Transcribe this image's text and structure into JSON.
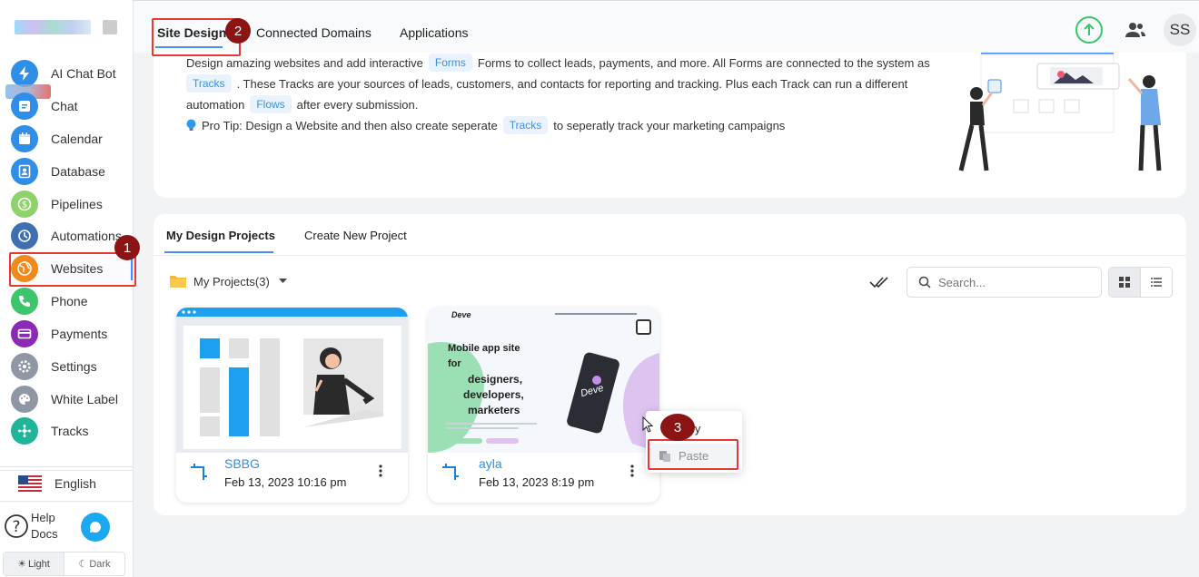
{
  "nav": {
    "items": [
      {
        "label": "AI Chat Bot",
        "icon": "bolt-icon",
        "color": "#2f8ee6"
      },
      {
        "label": "Chat",
        "icon": "chat-icon",
        "color": "#2f8ee6"
      },
      {
        "label": "Calendar",
        "icon": "calendar-icon",
        "color": "#2f8ee6"
      },
      {
        "label": "Database",
        "icon": "contacts-icon",
        "color": "#2f8ee6"
      },
      {
        "label": "Pipelines",
        "icon": "dollar-icon",
        "color": "#8fd16b"
      },
      {
        "label": "Automations",
        "icon": "automation-icon",
        "color": "#3e6fb0"
      },
      {
        "label": "Websites",
        "icon": "globe-icon",
        "color": "#f08a1c"
      },
      {
        "label": "Phone",
        "icon": "phone-icon",
        "color": "#3cc56a"
      },
      {
        "label": "Payments",
        "icon": "card-icon",
        "color": "#8b2bb5"
      },
      {
        "label": "Settings",
        "icon": "gear-icon",
        "color": "#8e97a3"
      },
      {
        "label": "White Label",
        "icon": "palette-icon",
        "color": "#8e97a3"
      },
      {
        "label": "Tracks",
        "icon": "tracks-icon",
        "color": "#20b59b"
      }
    ],
    "language": "English",
    "help": "Help",
    "docs": "Docs",
    "theme_light": "Light",
    "theme_dark": "Dark"
  },
  "tabs": {
    "site_designs": "Site Designs",
    "connected_domains": "Connected Domains",
    "applications": "Applications"
  },
  "header": {
    "avatar": "SS"
  },
  "intro": {
    "l1a": "Design amazing websites and add interactive",
    "pill_forms": "Forms",
    "l1b": "Forms to collect leads, payments, and more. All Forms are connected to the system as",
    "pill_tracks1": "Tracks",
    "l2": ". These Tracks are your sources of leads, customers, and contacts for reporting and tracking. Plus each Track can run a different",
    "l3a": "automation",
    "pill_flows": "Flows",
    "l3b": "after every submission.",
    "l4a": "Pro Tip: Design a Website and then also create seperate",
    "pill_tracks2": "Tracks",
    "l4b": "to seperatly track your marketing campaigns"
  },
  "projects": {
    "tab_my": "My Design Projects",
    "tab_create": "Create New Project",
    "folder": "My Projects(3)",
    "search_placeholder": "Search...",
    "items": [
      {
        "name": "SBBG",
        "date": "Feb 13, 2023 10:16 pm"
      },
      {
        "name": "ayla",
        "date": "Feb 13, 2023 8:19 pm"
      }
    ],
    "thumb2": {
      "brand": "Deve",
      "headline1": "Mobile app site",
      "headline2": "for",
      "headline3": "designers,",
      "headline4": "developers,",
      "headline5": "marketers",
      "phone_text": "Deve"
    }
  },
  "context_menu": {
    "copy": "Copy",
    "paste": "Paste"
  },
  "badges": [
    "1",
    "2",
    "3"
  ]
}
